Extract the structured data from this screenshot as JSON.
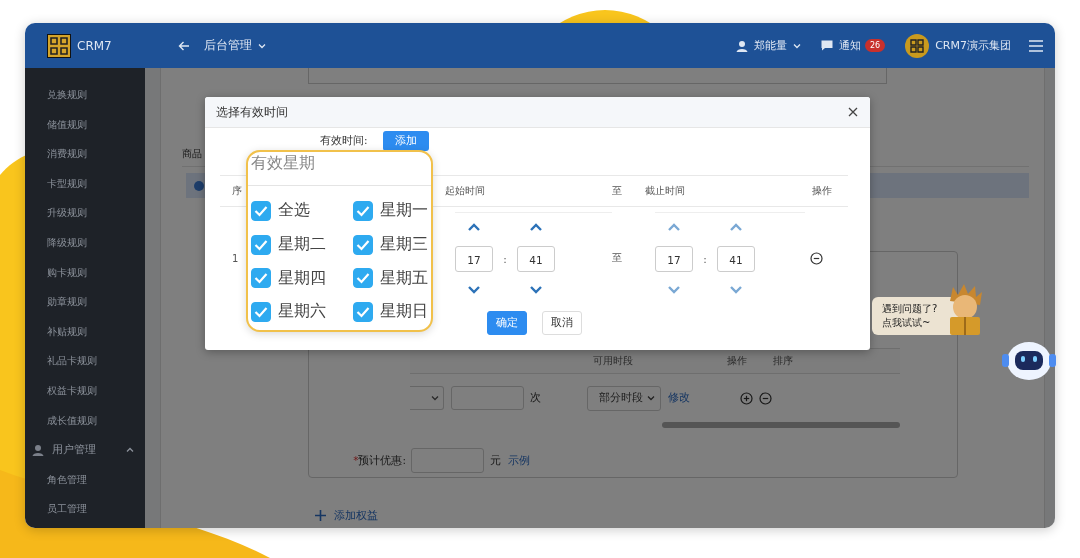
{
  "header": {
    "app_name": "CRM7",
    "section": "后台管理",
    "user": "郑能量",
    "notifications": {
      "label": "通知",
      "count": "26"
    },
    "org": "CRM7演示集团"
  },
  "sidebar": {
    "items": [
      {
        "label": "兑换规则",
        "kind": "item"
      },
      {
        "label": "储值规则",
        "kind": "item"
      },
      {
        "label": "消费规则",
        "kind": "item"
      },
      {
        "label": "卡型规则",
        "kind": "item"
      },
      {
        "label": "升级规则",
        "kind": "item"
      },
      {
        "label": "降级规则",
        "kind": "item"
      },
      {
        "label": "购卡规则",
        "kind": "item"
      },
      {
        "label": "勋章规则",
        "kind": "item"
      },
      {
        "label": "补贴规则",
        "kind": "item"
      },
      {
        "label": "礼品卡规则",
        "kind": "item"
      },
      {
        "label": "权益卡规则",
        "kind": "item"
      },
      {
        "label": "成长值规则",
        "kind": "item"
      },
      {
        "label": "用户管理",
        "kind": "group",
        "expanded": true,
        "children": [
          {
            "label": "角色管理"
          },
          {
            "label": "员工管理"
          }
        ]
      }
    ]
  },
  "background_form": {
    "product_label": "商品",
    "benefit_table": {
      "columns": [
        "可用时段",
        "操作",
        "排序"
      ],
      "row": {
        "unit": "次",
        "period": "部分时段",
        "edit_link": "修改"
      }
    },
    "discount": {
      "label": "预计优惠:",
      "required": true,
      "required_mark": "*",
      "unit": "元",
      "example_link": "示例"
    },
    "add_benefit": "添加权益"
  },
  "modal": {
    "title": "选择有效时间",
    "field_label": "有效时间:",
    "add_button": "添加",
    "table": {
      "columns": [
        "序",
        "起始时间",
        "至",
        "截止时间",
        "操作"
      ],
      "time_separator": ":",
      "rows": [
        {
          "index": "1",
          "start": {
            "hour": "17",
            "minute": "41"
          },
          "separator": "至",
          "end": {
            "hour": "17",
            "minute": "41"
          }
        }
      ]
    },
    "buttons": [
      {
        "label": "确定",
        "kind": "primary"
      },
      {
        "label": "取消",
        "kind": "default"
      }
    ]
  },
  "weekday_callout": {
    "title": "有效星期",
    "options": [
      {
        "label": "全选",
        "checked": true
      },
      {
        "label": "星期一",
        "checked": true
      },
      {
        "label": "星期二",
        "checked": true
      },
      {
        "label": "星期三",
        "checked": true
      },
      {
        "label": "星期四",
        "checked": true
      },
      {
        "label": "星期五",
        "checked": true
      },
      {
        "label": "星期六",
        "checked": true
      },
      {
        "label": "星期日",
        "checked": true
      }
    ]
  },
  "help": {
    "lines": [
      "遇到问题了?",
      "点我试试~"
    ]
  }
}
